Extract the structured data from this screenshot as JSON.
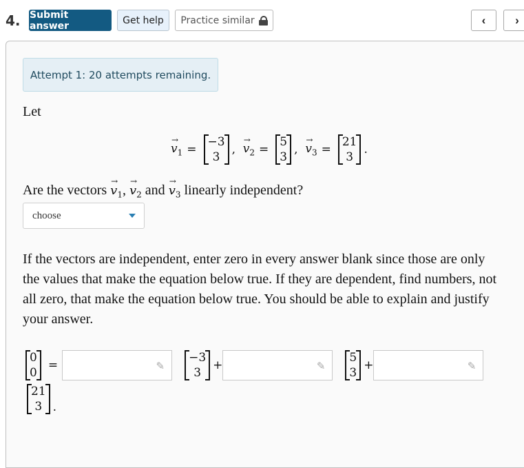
{
  "header": {
    "question_number": "4.",
    "submit_label": "Submit answer",
    "help_label": "Get help",
    "practice_label": "Practice similar",
    "prev_icon": "chevron-left-icon",
    "next_icon": "chevron-right-icon",
    "prev_glyph": "‹",
    "next_glyph": "›"
  },
  "attempt_text": "Attempt 1: 20 attempts remaining.",
  "intro": "Let",
  "vectors": [
    {
      "name": "v",
      "index": "1",
      "entries": [
        "−3",
        "3"
      ],
      "sep": ","
    },
    {
      "name": "v",
      "index": "2",
      "entries": [
        "5",
        "3"
      ],
      "sep": ","
    },
    {
      "name": "v",
      "index": "3",
      "entries": [
        "21",
        "3"
      ],
      "sep": "."
    }
  ],
  "question": {
    "prefix": "Are the vectors ",
    "v1": "v",
    "sub1": "1",
    "comma": ", ",
    "v2": "v",
    "sub2": "2",
    "and": " and ",
    "v3": "v",
    "sub3": "3",
    "suffix": " linearly independent?"
  },
  "select": {
    "value": "choose"
  },
  "instructions": "If the vectors are independent, enter zero in every answer blank since those are only the values that make the equation below true. If they are dependent, find numbers, not all zero, that make the equation below true. You should be able to explain and justify your answer.",
  "equation": {
    "zero_vector": [
      "0",
      "0"
    ],
    "equals": "=",
    "plus": "+",
    "terms": [
      [
        "−3",
        "3"
      ],
      [
        "5",
        "3"
      ],
      [
        "21",
        "3"
      ]
    ],
    "end": ".",
    "answers": [
      "",
      "",
      ""
    ]
  },
  "arrow_glyph": "⃗",
  "pencil_glyph": "✎"
}
